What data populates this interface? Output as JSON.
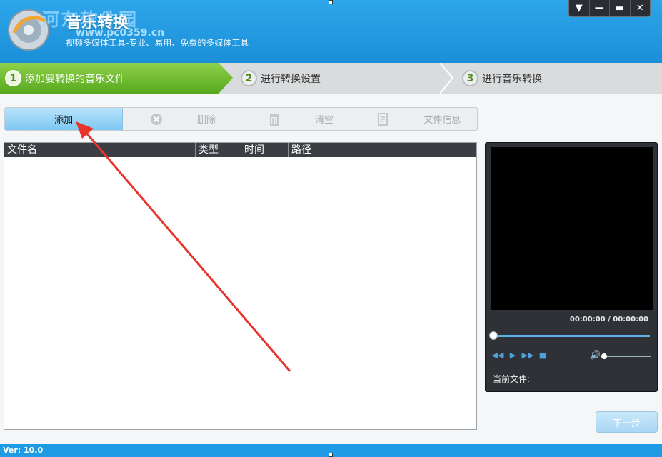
{
  "header": {
    "title": "音乐转换",
    "subtitle": "视频多媒体工具-专业、易用、免费的多媒体工具",
    "watermark": "河东软件园",
    "watermark_url": "www.pc0359.cn",
    "window_controls": [
      "▼",
      "—",
      "▬",
      "✕"
    ]
  },
  "steps": [
    {
      "num": "1",
      "label": "添加要转换的音乐文件"
    },
    {
      "num": "2",
      "label": "进行转换设置"
    },
    {
      "num": "3",
      "label": "进行音乐转换"
    }
  ],
  "toolbar": {
    "add_label": "添加",
    "delete_label": "删除",
    "clear_label": "清空",
    "info_label": "文件信息"
  },
  "filelist": {
    "columns": [
      "文件名",
      "类型",
      "时间",
      "路径"
    ]
  },
  "player": {
    "time": "00:00:00 / 00:00:00",
    "current_file_label": "当前文件:",
    "seek_progress": 0,
    "volume_level": 0
  },
  "next_label": "下一步",
  "status": {
    "version": "Ver: 10.0"
  },
  "colors": {
    "header_blue": "#1a8fd8",
    "step_active_green": "#6fbf2e",
    "annotation_red": "#e8352b"
  }
}
